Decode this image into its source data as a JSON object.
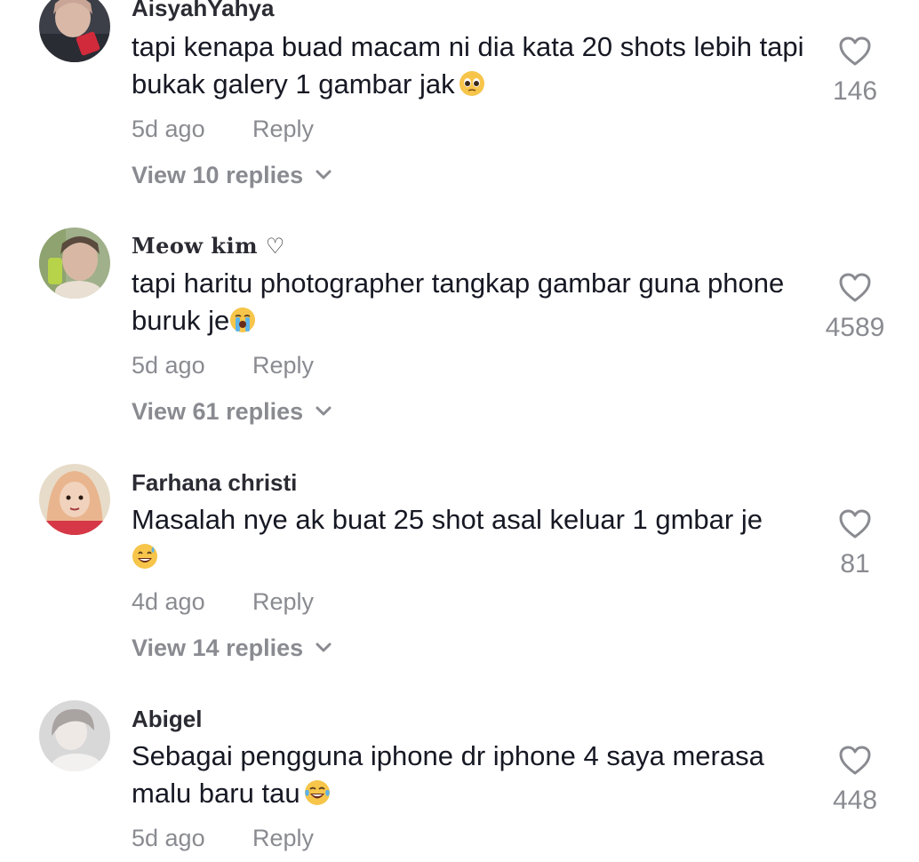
{
  "colors": {
    "text": "#161823",
    "secondary": "#8a8b91",
    "background": "#ffffff"
  },
  "comments": [
    {
      "username": "AisyahYahya",
      "text": "tapi kenapa buad macam ni dia kata 20 shots lebih tapi bukak galery 1 gambar jak",
      "emoji": "pleading-face-emoji",
      "time": "5d ago",
      "reply_label": "Reply",
      "view_replies": "View 10 replies",
      "likes": "146"
    },
    {
      "username": "Meow kim ♡",
      "text": "tapi haritu photographer tangkap gambar guna phone buruk je",
      "emoji": "loudly-crying-face-emoji",
      "time": "5d ago",
      "reply_label": "Reply",
      "view_replies": "View 61 replies",
      "likes": "4589"
    },
    {
      "username": "Farhana christi",
      "text": "Masalah nye ak buat 25 shot asal keluar 1 gmbar je",
      "emoji": "grinning-sweat-emoji",
      "time": "4d ago",
      "reply_label": "Reply",
      "view_replies": "View 14 replies",
      "likes": "81"
    },
    {
      "username": "Abigel",
      "text": "Sebagai pengguna iphone dr iphone 4 saya merasa malu baru tau",
      "emoji": "tears-of-joy-emoji",
      "time": "5d ago",
      "reply_label": "Reply",
      "likes": "448"
    }
  ]
}
